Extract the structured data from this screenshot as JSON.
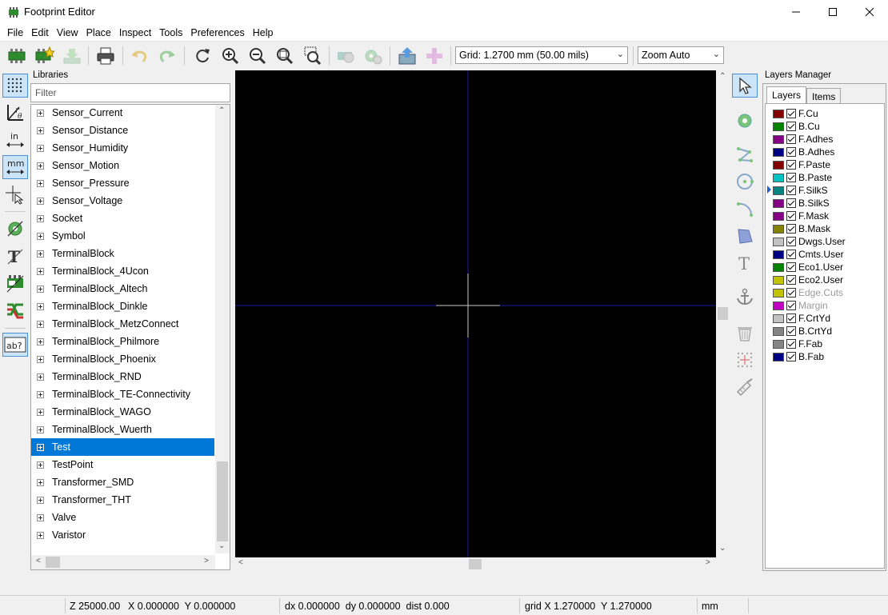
{
  "window": {
    "title": "Footprint Editor"
  },
  "menu": {
    "items": [
      "File",
      "Edit",
      "View",
      "Place",
      "Inspect",
      "Tools",
      "Preferences",
      "Help"
    ]
  },
  "toolbar": {
    "grid_value": "Grid: 1.2700 mm (50.00 mils)",
    "zoom_value": "Zoom Auto"
  },
  "lefttools": {
    "unit_in": "in",
    "unit_mm": "mm",
    "label_text": "ab?"
  },
  "libraries": {
    "title": "Libraries",
    "filter_placeholder": "Filter",
    "items": [
      "Sensor_Current",
      "Sensor_Distance",
      "Sensor_Humidity",
      "Sensor_Motion",
      "Sensor_Pressure",
      "Sensor_Voltage",
      "Socket",
      "Symbol",
      "TerminalBlock",
      "TerminalBlock_4Ucon",
      "TerminalBlock_Altech",
      "TerminalBlock_Dinkle",
      "TerminalBlock_MetzConnect",
      "TerminalBlock_Philmore",
      "TerminalBlock_Phoenix",
      "TerminalBlock_RND",
      "TerminalBlock_TE-Connectivity",
      "TerminalBlock_WAGO",
      "TerminalBlock_Wuerth",
      "Test",
      "TestPoint",
      "Transformer_SMD",
      "Transformer_THT",
      "Valve",
      "Varistor"
    ],
    "selected": "Test"
  },
  "layers_manager": {
    "title": "Layers Manager",
    "tabs": [
      "Layers",
      "Items"
    ],
    "active_tab": "Layers",
    "current_layer": "F.SilkS",
    "layers": [
      {
        "name": "F.Cu",
        "color": "#840000",
        "dim": false
      },
      {
        "name": "B.Cu",
        "color": "#008400",
        "dim": false
      },
      {
        "name": "F.Adhes",
        "color": "#840084",
        "dim": false
      },
      {
        "name": "B.Adhes",
        "color": "#000084",
        "dim": false
      },
      {
        "name": "F.Paste",
        "color": "#840000",
        "dim": false
      },
      {
        "name": "B.Paste",
        "color": "#00c2c2",
        "dim": false
      },
      {
        "name": "F.SilkS",
        "color": "#008484",
        "dim": false
      },
      {
        "name": "B.SilkS",
        "color": "#840084",
        "dim": false
      },
      {
        "name": "F.Mask",
        "color": "#840084",
        "dim": false
      },
      {
        "name": "B.Mask",
        "color": "#848400",
        "dim": false
      },
      {
        "name": "Dwgs.User",
        "color": "#c2c2c2",
        "dim": false
      },
      {
        "name": "Cmts.User",
        "color": "#000084",
        "dim": false
      },
      {
        "name": "Eco1.User",
        "color": "#008400",
        "dim": false
      },
      {
        "name": "Eco2.User",
        "color": "#c2c200",
        "dim": false
      },
      {
        "name": "Edge.Cuts",
        "color": "#c2c200",
        "dim": true
      },
      {
        "name": "Margin",
        "color": "#c200c2",
        "dim": true
      },
      {
        "name": "F.CrtYd",
        "color": "#c2c2c2",
        "dim": false
      },
      {
        "name": "B.CrtYd",
        "color": "#848484",
        "dim": false
      },
      {
        "name": "F.Fab",
        "color": "#848484",
        "dim": false
      },
      {
        "name": "B.Fab",
        "color": "#000084",
        "dim": false
      }
    ]
  },
  "statusbar": {
    "zoom": "Z 25000.00",
    "coords": "X 0.000000  Y 0.000000",
    "delta": "dx 0.000000  dy 0.000000  dist 0.000",
    "grid": "grid X 1.270000  Y 1.270000",
    "units": "mm"
  },
  "colors": {
    "canvas_bg": "#000000",
    "axis": "#1a1aa8",
    "cursor": "#c8c8c8",
    "selection": "#0078d7",
    "active_tool": "#cce4f7"
  }
}
